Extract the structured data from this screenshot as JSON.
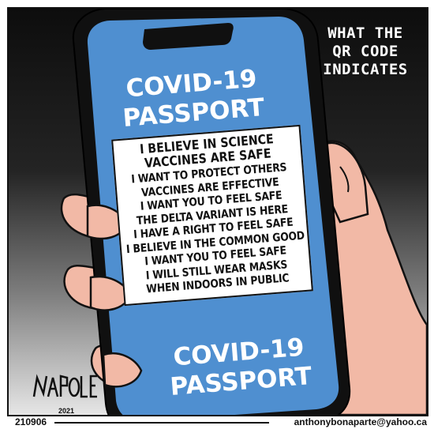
{
  "caption": {
    "line1": "WHAT THE",
    "line2": "QR CODE",
    "line3": "INDICATES"
  },
  "passport": {
    "top_line1": "COVID-19",
    "top_line2": "PASSPORT",
    "bottom_line1": "COVID-19",
    "bottom_line2": "PASSPORT"
  },
  "statements": [
    "I BELIEVE IN SCIENCE",
    "VACCINES ARE SAFE",
    "I WANT TO PROTECT OTHERS",
    "VACCINES ARE EFFECTIVE",
    "I WANT YOU TO FEEL SAFE",
    "THE DELTA VARIANT IS HERE",
    "I HAVE A RIGHT TO FEEL SAFE",
    "I BELIEVE IN THE COMMON GOOD",
    "I WANT YOU TO FEEL SAFE",
    "I WILL STILL WEAR MASKS",
    "WHEN INDOORS IN PUBLIC"
  ],
  "signature": {
    "name": "NAPOLEON",
    "year": "2021"
  },
  "footer": {
    "id": "210906",
    "email": "anthonybonaparte@yahoo.ca"
  },
  "colors": {
    "screen": "#4f8fd0",
    "skin": "#f2b9a6",
    "frame": "#111111"
  }
}
